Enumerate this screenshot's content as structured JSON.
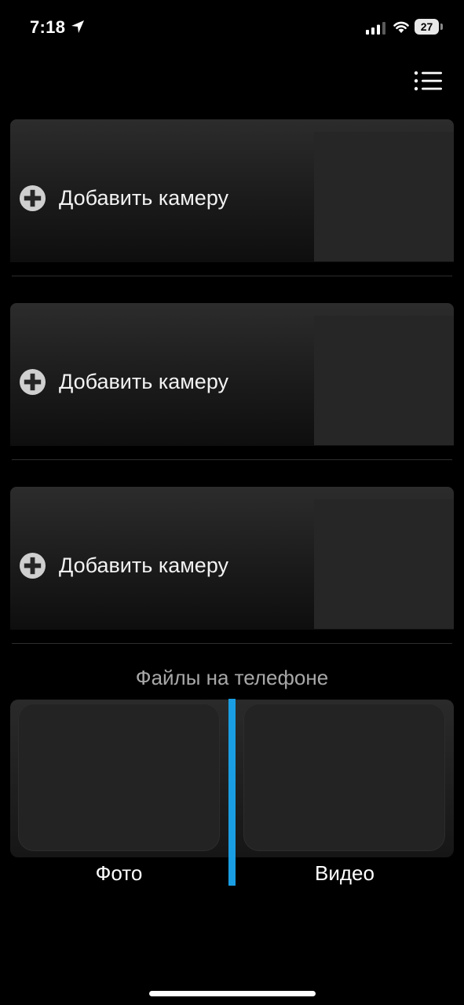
{
  "status_bar": {
    "time": "7:18",
    "battery_level": "27",
    "icons": [
      "location-arrow-icon",
      "cellular-signal-icon",
      "wifi-icon",
      "battery-icon"
    ]
  },
  "header": {
    "menu_icon": "list-menu-icon"
  },
  "cameras": [
    {
      "label": "Добавить камеру",
      "icon": "plus-circle-icon"
    },
    {
      "label": "Добавить камеру",
      "icon": "plus-circle-icon"
    },
    {
      "label": "Добавить камеру",
      "icon": "plus-circle-icon"
    }
  ],
  "files": {
    "title": "Файлы на телефоне",
    "photo_label": "Фото",
    "video_label": "Видео"
  },
  "colors": {
    "background": "#000000",
    "card": "#1c1c1c",
    "accent": "#1a9ee3",
    "muted_text": "#a8a8a8"
  }
}
